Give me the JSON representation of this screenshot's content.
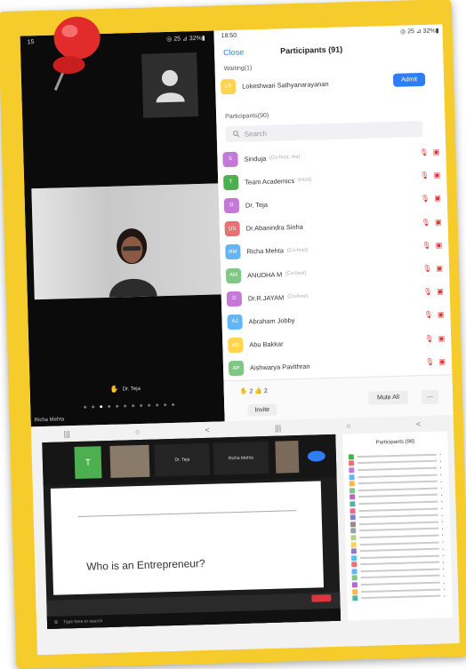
{
  "left_phone": {
    "status_time": "15",
    "status_right": "◎ 25 ⊿ 32%▮",
    "active_speaker": "Dr. Teja",
    "self_name": "Richa Mehta"
  },
  "right_phone": {
    "status_time": "18:50",
    "status_right": "◎ 25 ⊿ 32%▮",
    "close_label": "Close",
    "title": "Participants (91)",
    "waiting_label": "Waiting(1)",
    "waiting_name": "Lokeshwari Sathyanarayanan",
    "admit_label": "Admit",
    "participants_label": "Participants(90)",
    "search_placeholder": "Search",
    "participants": [
      {
        "initials": "S",
        "name": "Sinduja",
        "tag": "(Co-host, me)",
        "color": "#c479d8"
      },
      {
        "initials": "T",
        "name": "Team Academics",
        "tag": "(Host)",
        "color": "#4caf50"
      },
      {
        "initials": "D",
        "name": "Dr. Teja",
        "tag": "",
        "color": "#c479d8"
      },
      {
        "initials": "DS",
        "name": "Dr.Abanindra Sinha",
        "tag": "",
        "color": "#e57373"
      },
      {
        "initials": "RM",
        "name": "Richa Mehta",
        "tag": "(Co-host)",
        "color": "#64b5f6"
      },
      {
        "initials": "AM",
        "name": "ANUDHA M",
        "tag": "(Co-host)",
        "color": "#81c784"
      },
      {
        "initials": "D",
        "name": "Dr.R.JAYAM",
        "tag": "(Co-host)",
        "color": "#c479d8"
      },
      {
        "initials": "AJ",
        "name": "Abraham Jobby",
        "tag": "",
        "color": "#64b5f6"
      },
      {
        "initials": "AB",
        "name": "Abu Bakkar",
        "tag": "",
        "color": "#ffd54f"
      },
      {
        "initials": "AP",
        "name": "Aishwarya Pavithran",
        "tag": "",
        "color": "#81c784"
      }
    ],
    "reactions": "✋ 2   👍 2",
    "invite_label": "Invite",
    "mute_all_label": "Mute All",
    "more_label": "⋯"
  },
  "desktop": {
    "tile_1": "Dr. Teja",
    "tile_2": "Richa Mehta",
    "slide_title": "Who is an Entrepreneur?",
    "task_search": "Type here to search",
    "panel_title": "Participants (98)"
  }
}
